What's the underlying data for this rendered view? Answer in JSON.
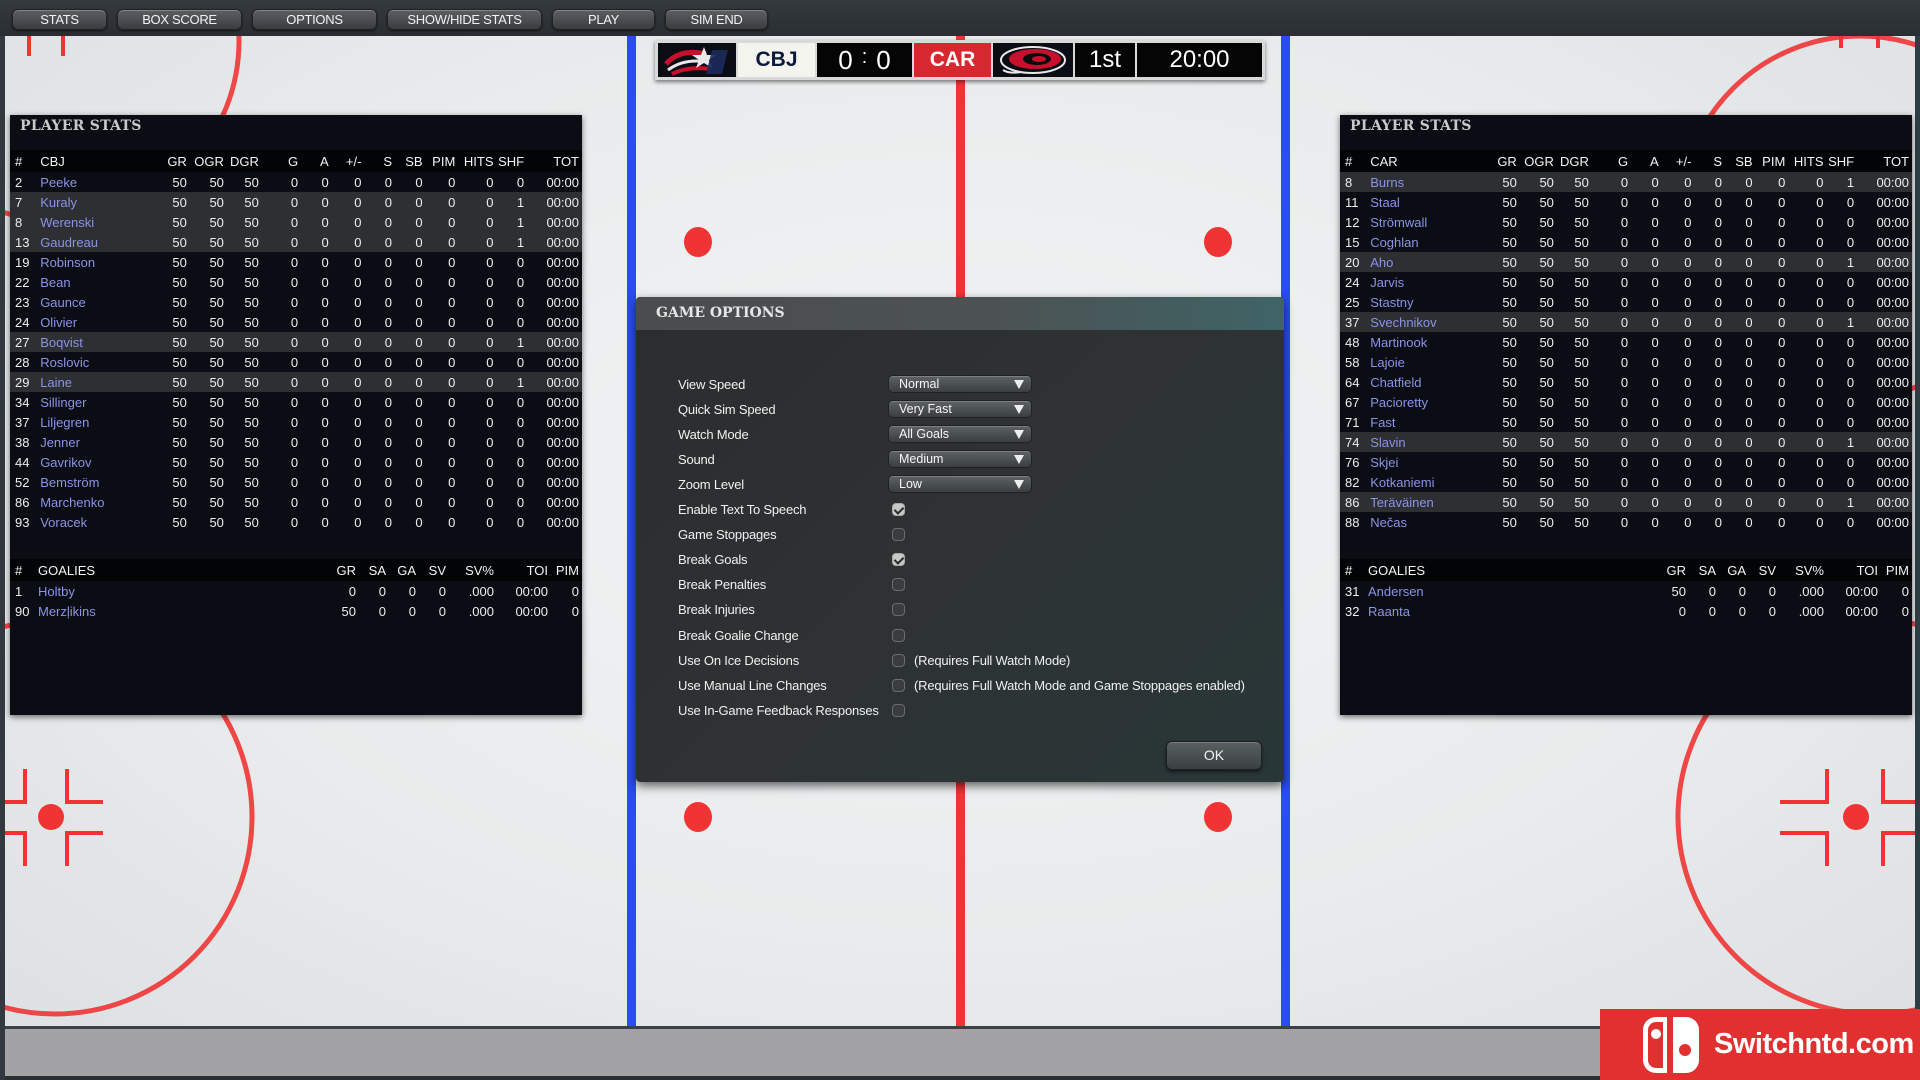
{
  "toolbar": {
    "buttons": [
      {
        "label": "STATS"
      },
      {
        "label": "BOX SCORE"
      },
      {
        "label": "OPTIONS"
      },
      {
        "label": "SHOW/HIDE STATS"
      },
      {
        "label": "PLAY"
      },
      {
        "label": "SIM END"
      }
    ]
  },
  "scoreboard": {
    "home_team": "CBJ",
    "home_logo_icon": "blue-jackets-logo-icon",
    "home_score": "0",
    "separator": ":",
    "away_score": "0",
    "away_team": "CAR",
    "away_logo_icon": "hurricanes-logo-icon",
    "period": "1st",
    "clock": "20:00",
    "colors": {
      "home_bg": "#f4f4ef",
      "away_bg": "#d7282f"
    }
  },
  "left_panel": {
    "title": "PLAYER STATS",
    "skater_headers": [
      "#",
      "CBJ",
      "GR",
      "OGR",
      "DGR",
      "G",
      "A",
      "+/-",
      "S",
      "SB",
      "PIM",
      "HITS",
      "SHF",
      "TOT"
    ],
    "skaters": [
      {
        "num": "2",
        "name": "Peeke",
        "gr": "50",
        "ogr": "50",
        "dgr": "50",
        "g": "0",
        "a": "0",
        "pm": "0",
        "s": "0",
        "sb": "0",
        "pim": "0",
        "hits": "0",
        "shf": "0",
        "tot": "00:00",
        "on_ice": false
      },
      {
        "num": "7",
        "name": "Kuraly",
        "gr": "50",
        "ogr": "50",
        "dgr": "50",
        "g": "0",
        "a": "0",
        "pm": "0",
        "s": "0",
        "sb": "0",
        "pim": "0",
        "hits": "0",
        "shf": "1",
        "tot": "00:00",
        "on_ice": true
      },
      {
        "num": "8",
        "name": "Werenski",
        "gr": "50",
        "ogr": "50",
        "dgr": "50",
        "g": "0",
        "a": "0",
        "pm": "0",
        "s": "0",
        "sb": "0",
        "pim": "0",
        "hits": "0",
        "shf": "1",
        "tot": "00:00",
        "on_ice": true
      },
      {
        "num": "13",
        "name": "Gaudreau",
        "gr": "50",
        "ogr": "50",
        "dgr": "50",
        "g": "0",
        "a": "0",
        "pm": "0",
        "s": "0",
        "sb": "0",
        "pim": "0",
        "hits": "0",
        "shf": "1",
        "tot": "00:00",
        "on_ice": true
      },
      {
        "num": "19",
        "name": "Robinson",
        "gr": "50",
        "ogr": "50",
        "dgr": "50",
        "g": "0",
        "a": "0",
        "pm": "0",
        "s": "0",
        "sb": "0",
        "pim": "0",
        "hits": "0",
        "shf": "0",
        "tot": "00:00",
        "on_ice": false
      },
      {
        "num": "22",
        "name": "Bean",
        "gr": "50",
        "ogr": "50",
        "dgr": "50",
        "g": "0",
        "a": "0",
        "pm": "0",
        "s": "0",
        "sb": "0",
        "pim": "0",
        "hits": "0",
        "shf": "0",
        "tot": "00:00",
        "on_ice": false
      },
      {
        "num": "23",
        "name": "Gaunce",
        "gr": "50",
        "ogr": "50",
        "dgr": "50",
        "g": "0",
        "a": "0",
        "pm": "0",
        "s": "0",
        "sb": "0",
        "pim": "0",
        "hits": "0",
        "shf": "0",
        "tot": "00:00",
        "on_ice": false
      },
      {
        "num": "24",
        "name": "Olivier",
        "gr": "50",
        "ogr": "50",
        "dgr": "50",
        "g": "0",
        "a": "0",
        "pm": "0",
        "s": "0",
        "sb": "0",
        "pim": "0",
        "hits": "0",
        "shf": "0",
        "tot": "00:00",
        "on_ice": false
      },
      {
        "num": "27",
        "name": "Boqvist",
        "gr": "50",
        "ogr": "50",
        "dgr": "50",
        "g": "0",
        "a": "0",
        "pm": "0",
        "s": "0",
        "sb": "0",
        "pim": "0",
        "hits": "0",
        "shf": "1",
        "tot": "00:00",
        "on_ice": true
      },
      {
        "num": "28",
        "name": "Roslovic",
        "gr": "50",
        "ogr": "50",
        "dgr": "50",
        "g": "0",
        "a": "0",
        "pm": "0",
        "s": "0",
        "sb": "0",
        "pim": "0",
        "hits": "0",
        "shf": "0",
        "tot": "00:00",
        "on_ice": false
      },
      {
        "num": "29",
        "name": "Laine",
        "gr": "50",
        "ogr": "50",
        "dgr": "50",
        "g": "0",
        "a": "0",
        "pm": "0",
        "s": "0",
        "sb": "0",
        "pim": "0",
        "hits": "0",
        "shf": "1",
        "tot": "00:00",
        "on_ice": true
      },
      {
        "num": "34",
        "name": "Sillinger",
        "gr": "50",
        "ogr": "50",
        "dgr": "50",
        "g": "0",
        "a": "0",
        "pm": "0",
        "s": "0",
        "sb": "0",
        "pim": "0",
        "hits": "0",
        "shf": "0",
        "tot": "00:00",
        "on_ice": false
      },
      {
        "num": "37",
        "name": "Liljegren",
        "gr": "50",
        "ogr": "50",
        "dgr": "50",
        "g": "0",
        "a": "0",
        "pm": "0",
        "s": "0",
        "sb": "0",
        "pim": "0",
        "hits": "0",
        "shf": "0",
        "tot": "00:00",
        "on_ice": false
      },
      {
        "num": "38",
        "name": "Jenner",
        "gr": "50",
        "ogr": "50",
        "dgr": "50",
        "g": "0",
        "a": "0",
        "pm": "0",
        "s": "0",
        "sb": "0",
        "pim": "0",
        "hits": "0",
        "shf": "0",
        "tot": "00:00",
        "on_ice": false
      },
      {
        "num": "44",
        "name": "Gavrikov",
        "gr": "50",
        "ogr": "50",
        "dgr": "50",
        "g": "0",
        "a": "0",
        "pm": "0",
        "s": "0",
        "sb": "0",
        "pim": "0",
        "hits": "0",
        "shf": "0",
        "tot": "00:00",
        "on_ice": false
      },
      {
        "num": "52",
        "name": "Bemström",
        "gr": "50",
        "ogr": "50",
        "dgr": "50",
        "g": "0",
        "a": "0",
        "pm": "0",
        "s": "0",
        "sb": "0",
        "pim": "0",
        "hits": "0",
        "shf": "0",
        "tot": "00:00",
        "on_ice": false
      },
      {
        "num": "86",
        "name": "Marchenko",
        "gr": "50",
        "ogr": "50",
        "dgr": "50",
        "g": "0",
        "a": "0",
        "pm": "0",
        "s": "0",
        "sb": "0",
        "pim": "0",
        "hits": "0",
        "shf": "0",
        "tot": "00:00",
        "on_ice": false
      },
      {
        "num": "93",
        "name": "Voracek",
        "gr": "50",
        "ogr": "50",
        "dgr": "50",
        "g": "0",
        "a": "0",
        "pm": "0",
        "s": "0",
        "sb": "0",
        "pim": "0",
        "hits": "0",
        "shf": "0",
        "tot": "00:00",
        "on_ice": false
      }
    ],
    "goalie_headers": [
      "#",
      "GOALIES",
      "GR",
      "SA",
      "GA",
      "SV",
      "SV%",
      "TOI",
      "PIM"
    ],
    "goalies": [
      {
        "num": "1",
        "name": "Holtby",
        "gr": "0",
        "sa": "0",
        "ga": "0",
        "sv": "0",
        "svpct": ".000",
        "toi": "00:00",
        "pim": "0"
      },
      {
        "num": "90",
        "name": "Merzļikins",
        "gr": "50",
        "sa": "0",
        "ga": "0",
        "sv": "0",
        "svpct": ".000",
        "toi": "00:00",
        "pim": "0"
      }
    ]
  },
  "right_panel": {
    "title": "PLAYER STATS",
    "skater_headers": [
      "#",
      "CAR",
      "GR",
      "OGR",
      "DGR",
      "G",
      "A",
      "+/-",
      "S",
      "SB",
      "PIM",
      "HITS",
      "SHF",
      "TOT"
    ],
    "skaters": [
      {
        "num": "8",
        "name": "Burns",
        "gr": "50",
        "ogr": "50",
        "dgr": "50",
        "g": "0",
        "a": "0",
        "pm": "0",
        "s": "0",
        "sb": "0",
        "pim": "0",
        "hits": "0",
        "shf": "1",
        "tot": "00:00",
        "on_ice": true
      },
      {
        "num": "11",
        "name": "Staal",
        "gr": "50",
        "ogr": "50",
        "dgr": "50",
        "g": "0",
        "a": "0",
        "pm": "0",
        "s": "0",
        "sb": "0",
        "pim": "0",
        "hits": "0",
        "shf": "0",
        "tot": "00:00",
        "on_ice": false
      },
      {
        "num": "12",
        "name": "Strömwall",
        "gr": "50",
        "ogr": "50",
        "dgr": "50",
        "g": "0",
        "a": "0",
        "pm": "0",
        "s": "0",
        "sb": "0",
        "pim": "0",
        "hits": "0",
        "shf": "0",
        "tot": "00:00",
        "on_ice": false
      },
      {
        "num": "15",
        "name": "Coghlan",
        "gr": "50",
        "ogr": "50",
        "dgr": "50",
        "g": "0",
        "a": "0",
        "pm": "0",
        "s": "0",
        "sb": "0",
        "pim": "0",
        "hits": "0",
        "shf": "0",
        "tot": "00:00",
        "on_ice": false
      },
      {
        "num": "20",
        "name": "Aho",
        "gr": "50",
        "ogr": "50",
        "dgr": "50",
        "g": "0",
        "a": "0",
        "pm": "0",
        "s": "0",
        "sb": "0",
        "pim": "0",
        "hits": "0",
        "shf": "1",
        "tot": "00:00",
        "on_ice": true
      },
      {
        "num": "24",
        "name": "Jarvis",
        "gr": "50",
        "ogr": "50",
        "dgr": "50",
        "g": "0",
        "a": "0",
        "pm": "0",
        "s": "0",
        "sb": "0",
        "pim": "0",
        "hits": "0",
        "shf": "0",
        "tot": "00:00",
        "on_ice": false
      },
      {
        "num": "25",
        "name": "Stastny",
        "gr": "50",
        "ogr": "50",
        "dgr": "50",
        "g": "0",
        "a": "0",
        "pm": "0",
        "s": "0",
        "sb": "0",
        "pim": "0",
        "hits": "0",
        "shf": "0",
        "tot": "00:00",
        "on_ice": false
      },
      {
        "num": "37",
        "name": "Svechnikov",
        "gr": "50",
        "ogr": "50",
        "dgr": "50",
        "g": "0",
        "a": "0",
        "pm": "0",
        "s": "0",
        "sb": "0",
        "pim": "0",
        "hits": "0",
        "shf": "1",
        "tot": "00:00",
        "on_ice": true
      },
      {
        "num": "48",
        "name": "Martinook",
        "gr": "50",
        "ogr": "50",
        "dgr": "50",
        "g": "0",
        "a": "0",
        "pm": "0",
        "s": "0",
        "sb": "0",
        "pim": "0",
        "hits": "0",
        "shf": "0",
        "tot": "00:00",
        "on_ice": false
      },
      {
        "num": "58",
        "name": "Lajoie",
        "gr": "50",
        "ogr": "50",
        "dgr": "50",
        "g": "0",
        "a": "0",
        "pm": "0",
        "s": "0",
        "sb": "0",
        "pim": "0",
        "hits": "0",
        "shf": "0",
        "tot": "00:00",
        "on_ice": false
      },
      {
        "num": "64",
        "name": "Chatfield",
        "gr": "50",
        "ogr": "50",
        "dgr": "50",
        "g": "0",
        "a": "0",
        "pm": "0",
        "s": "0",
        "sb": "0",
        "pim": "0",
        "hits": "0",
        "shf": "0",
        "tot": "00:00",
        "on_ice": false
      },
      {
        "num": "67",
        "name": "Pacioretty",
        "gr": "50",
        "ogr": "50",
        "dgr": "50",
        "g": "0",
        "a": "0",
        "pm": "0",
        "s": "0",
        "sb": "0",
        "pim": "0",
        "hits": "0",
        "shf": "0",
        "tot": "00:00",
        "on_ice": false
      },
      {
        "num": "71",
        "name": "Fast",
        "gr": "50",
        "ogr": "50",
        "dgr": "50",
        "g": "0",
        "a": "0",
        "pm": "0",
        "s": "0",
        "sb": "0",
        "pim": "0",
        "hits": "0",
        "shf": "0",
        "tot": "00:00",
        "on_ice": false
      },
      {
        "num": "74",
        "name": "Slavin",
        "gr": "50",
        "ogr": "50",
        "dgr": "50",
        "g": "0",
        "a": "0",
        "pm": "0",
        "s": "0",
        "sb": "0",
        "pim": "0",
        "hits": "0",
        "shf": "1",
        "tot": "00:00",
        "on_ice": true
      },
      {
        "num": "76",
        "name": "Skjei",
        "gr": "50",
        "ogr": "50",
        "dgr": "50",
        "g": "0",
        "a": "0",
        "pm": "0",
        "s": "0",
        "sb": "0",
        "pim": "0",
        "hits": "0",
        "shf": "0",
        "tot": "00:00",
        "on_ice": false
      },
      {
        "num": "82",
        "name": "Kotkaniemi",
        "gr": "50",
        "ogr": "50",
        "dgr": "50",
        "g": "0",
        "a": "0",
        "pm": "0",
        "s": "0",
        "sb": "0",
        "pim": "0",
        "hits": "0",
        "shf": "0",
        "tot": "00:00",
        "on_ice": false
      },
      {
        "num": "86",
        "name": "Teräväinen",
        "gr": "50",
        "ogr": "50",
        "dgr": "50",
        "g": "0",
        "a": "0",
        "pm": "0",
        "s": "0",
        "sb": "0",
        "pim": "0",
        "hits": "0",
        "shf": "1",
        "tot": "00:00",
        "on_ice": true
      },
      {
        "num": "88",
        "name": "Nečas",
        "gr": "50",
        "ogr": "50",
        "dgr": "50",
        "g": "0",
        "a": "0",
        "pm": "0",
        "s": "0",
        "sb": "0",
        "pim": "0",
        "hits": "0",
        "shf": "0",
        "tot": "00:00",
        "on_ice": false
      }
    ],
    "goalie_headers": [
      "#",
      "GOALIES",
      "GR",
      "SA",
      "GA",
      "SV",
      "SV%",
      "TOI",
      "PIM"
    ],
    "goalies": [
      {
        "num": "31",
        "name": "Andersen",
        "gr": "50",
        "sa": "0",
        "ga": "0",
        "sv": "0",
        "svpct": ".000",
        "toi": "00:00",
        "pim": "0"
      },
      {
        "num": "32",
        "name": "Raanta",
        "gr": "0",
        "sa": "0",
        "ga": "0",
        "sv": "0",
        "svpct": ".000",
        "toi": "00:00",
        "pim": "0"
      }
    ]
  },
  "dialog": {
    "title": "GAME OPTIONS",
    "dropdowns": [
      {
        "label": "View Speed",
        "value": "Normal"
      },
      {
        "label": "Quick Sim Speed",
        "value": "Very Fast"
      },
      {
        "label": "Watch Mode",
        "value": "All Goals"
      },
      {
        "label": "Sound",
        "value": "Medium"
      },
      {
        "label": "Zoom Level",
        "value": "Low"
      }
    ],
    "checkboxes": [
      {
        "label": "Enable Text To Speech",
        "checked": true,
        "note": ""
      },
      {
        "label": "Game Stoppages",
        "checked": false,
        "note": ""
      },
      {
        "label": "Break Goals",
        "checked": true,
        "note": ""
      },
      {
        "label": "Break Penalties",
        "checked": false,
        "note": ""
      },
      {
        "label": "Break Injuries",
        "checked": false,
        "note": ""
      },
      {
        "label": "Break Goalie Change",
        "checked": false,
        "note": ""
      },
      {
        "label": "Use On Ice Decisions",
        "checked": false,
        "note": "(Requires Full Watch Mode)"
      },
      {
        "label": "Use Manual Line Changes",
        "checked": false,
        "note": "(Requires Full Watch Mode and Game Stoppages enabled)"
      },
      {
        "label": "Use In-Game Feedback Responses",
        "checked": false,
        "note": ""
      }
    ],
    "ok_label": "OK"
  },
  "watermark": {
    "text": "Switchntd.com",
    "icon": "nintendo-switch-logo-icon",
    "color": "#e0302f"
  },
  "rink_colors": {
    "red_line": "#f03434",
    "blue_line": "#2a4cf0"
  }
}
